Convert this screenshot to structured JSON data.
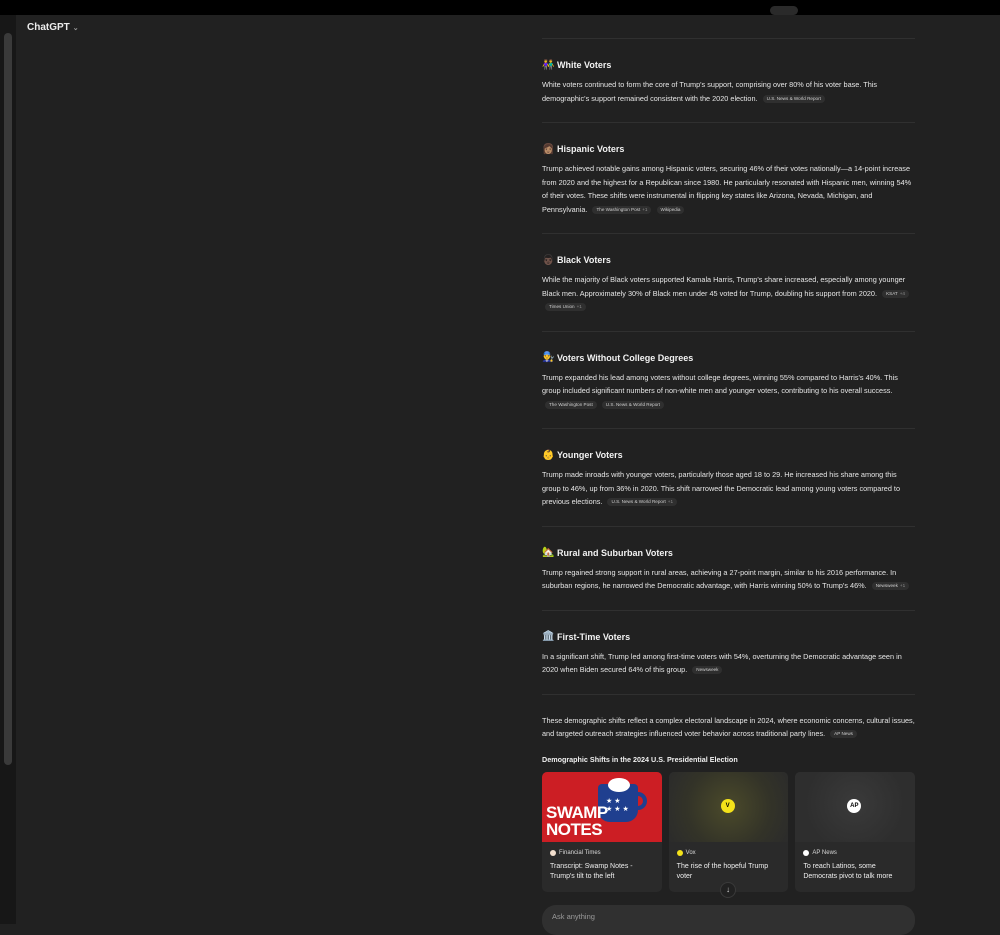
{
  "app": {
    "model_label": "ChatGPT"
  },
  "sections": [
    {
      "emoji": "👫",
      "title": "White Voters",
      "text": "White voters continued to form the core of Trump's support, comprising over 80% of his voter base. This demographic's support remained consistent with the 2020 election.",
      "sources": [
        {
          "label": "U.S. News & World Report",
          "plus": ""
        }
      ]
    },
    {
      "emoji": "👩🏽",
      "title": "Hispanic Voters",
      "text": "Trump achieved notable gains among Hispanic voters, securing 46% of their votes nationally—a 14-point increase from 2020 and the highest for a Republican since 1980. He particularly resonated with Hispanic men, winning 54% of their votes. These shifts were instrumental in flipping key states like Arizona, Nevada, Michigan, and Pennsylvania.",
      "sources": [
        {
          "label": "The Washington Post",
          "plus": "+1"
        },
        {
          "label": "Wikipedia",
          "plus": ""
        }
      ]
    },
    {
      "emoji": "👨🏿",
      "title": "Black Voters",
      "text": "While the majority of Black voters supported Kamala Harris, Trump's share increased, especially among younger Black men. Approximately 30% of Black men under 45 voted for Trump, doubling his support from 2020.",
      "sources": [
        {
          "label": "KSAT",
          "plus": "+4"
        },
        {
          "label": "Times Union",
          "plus": "+1"
        }
      ]
    },
    {
      "emoji": "👨‍🔧",
      "title": "Voters Without College Degrees",
      "text": "Trump expanded his lead among voters without college degrees, winning 55% compared to Harris's 40%. This group included significant numbers of non-white men and younger voters, contributing to his overall success.",
      "sources": [
        {
          "label": "The Washington Post",
          "plus": ""
        },
        {
          "label": "U.S. News & World Report",
          "plus": ""
        }
      ]
    },
    {
      "emoji": "👶",
      "title": "Younger Voters",
      "text": "Trump made inroads with younger voters, particularly those aged 18 to 29. He increased his share among this group to 46%, up from 36% in 2020. This shift narrowed the Democratic lead among young voters compared to previous elections.",
      "sources": [
        {
          "label": "U.S. News & World Report",
          "plus": "+1"
        }
      ]
    },
    {
      "emoji": "🏡",
      "title": "Rural and Suburban Voters",
      "text": "Trump regained strong support in rural areas, achieving a 27-point margin, similar to his 2016 performance. In suburban regions, he narrowed the Democratic advantage, with Harris winning 50% to Trump's 46%.",
      "sources": [
        {
          "label": "Newsweek",
          "plus": "+1"
        }
      ]
    },
    {
      "emoji": "🏛️",
      "title": "First-Time Voters",
      "text": "In a significant shift, Trump led among first-time voters with 54%, overturning the Democratic advantage seen in 2020 when Biden secured 64% of this group.",
      "sources": [
        {
          "label": "Newsweek",
          "plus": ""
        }
      ]
    }
  ],
  "conclusion": {
    "text": "These demographic shifts reflect a complex electoral landscape in 2024, where economic concerns, cultural issues, and targeted outreach strategies influenced voter behavior across traditional party lines.",
    "source": "AP News"
  },
  "cards_title": "Demographic Shifts in the 2024 U.S. Presidential Election",
  "cards": [
    {
      "source": "Financial Times",
      "title": "Transcript: Swamp Notes - Trump's tilt to the left",
      "thumb_text_1": "SWAMP",
      "thumb_text_2": "NOTES",
      "dot_color": "#f2dfce"
    },
    {
      "source": "Vox",
      "title": "The rise of the hopeful Trump voter",
      "logo": "V",
      "dot_color": "#f4e21a"
    },
    {
      "source": "AP News",
      "title": "To reach Latinos, some Democrats pivot to talk more",
      "logo": "AP",
      "dot_color": "#ffffff"
    }
  ],
  "composer": {
    "placeholder": "Ask anything"
  },
  "icons": {
    "scroll_down": "arrow-down-icon",
    "model_menu": "chevron-down-icon"
  }
}
